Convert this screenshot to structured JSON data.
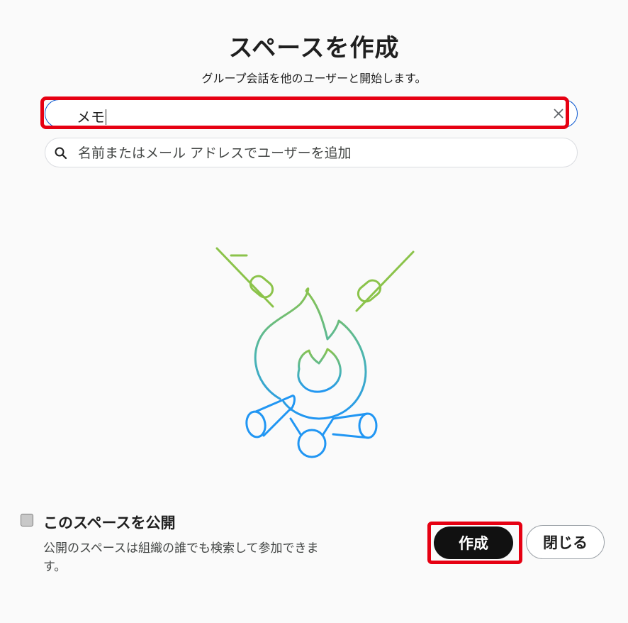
{
  "dialog": {
    "title": "スペースを作成",
    "subtitle": "グループ会話を他のユーザーと開始します。"
  },
  "space_name": {
    "value": "メモ"
  },
  "people_search": {
    "placeholder": "名前またはメール アドレスでユーザーを追加"
  },
  "public_option": {
    "label": "このスペースを公開",
    "description": "公開のスペースは組織の誰でも検索して参加できます。",
    "checked": false
  },
  "buttons": {
    "create": "作成",
    "close": "閉じる"
  },
  "icons": {
    "clear": "close-icon",
    "search": "search-icon",
    "illustration": "campfire-illustration"
  },
  "colors": {
    "highlight": "#e60012",
    "primary_button": "#111111",
    "input_focus": "#0b57d0",
    "illustration_top": "#8bc34a",
    "illustration_bottom": "#2196f3"
  }
}
